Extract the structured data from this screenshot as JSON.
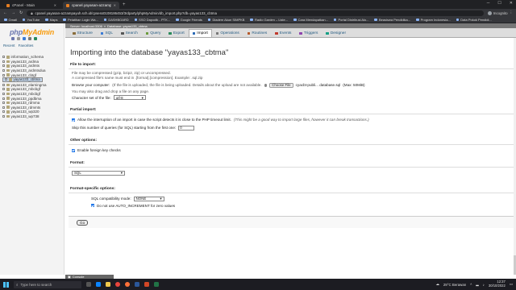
{
  "browser": {
    "tabs": [
      {
        "title": "cPanel - Main",
        "active": false
      },
      {
        "title": "cpanel.yayasan-azzampayuh.sch.id",
        "active": true
      }
    ],
    "new_tab_label": "+",
    "url": "cpanel.yayasan-azzampayuh.sch.id/cpsess0108186453/3rdparty/phpMyAdmin/db_import.php?db=yayas133_cbtma",
    "profile_label": "Incognito",
    "bookmarks": [
      "Gmail",
      "YouTube",
      "Maps",
      "Pelatihan Login Wa...",
      "DASHBOARD",
      "SSO Dapodik - PTK...",
      "Google Friends",
      "Diadem Akun SIMPKB",
      "Radio Garden – Liste...",
      "Cara Mendapatkan...",
      "Portal Distribusi Alo...",
      "Beasiswa Pendidika...",
      "Program Indonesia...",
      "Data Pokok Pendidi..."
    ]
  },
  "sidebar": {
    "logo_a": "php",
    "logo_b": "MyAdmin",
    "recent_label": "Recent",
    "favorites_label": "Favorites",
    "databases": [
      {
        "name": "information_schema",
        "selected": false
      },
      {
        "name": "yayas133_ardma",
        "selected": false
      },
      {
        "name": "yayas133_ardmts",
        "selected": false
      },
      {
        "name": "yayas133_ardmtsdua",
        "selected": false
      },
      {
        "name": "yayas133_cbtgf",
        "selected": false
      },
      {
        "name": "yayas133_cbtma",
        "selected": true
      },
      {
        "name": "yayas133_elarningma",
        "selected": false
      },
      {
        "name": "yayas133_mbcbgf",
        "selected": false
      },
      {
        "name": "yayas133_mbcbgf",
        "selected": false
      },
      {
        "name": "yayas133_ppdbma",
        "selected": false
      },
      {
        "name": "yayas133_rdmma",
        "selected": false
      },
      {
        "name": "yayas133_rdmmts",
        "selected": false
      },
      {
        "name": "yayas133_wp320",
        "selected": false
      },
      {
        "name": "yayas133_wp738",
        "selected": false
      }
    ]
  },
  "breadcrumb": {
    "server": "Server: localhost:3306",
    "database": "Database: yayas133_cbtma"
  },
  "nav_tabs": [
    {
      "label": "Structure",
      "icon": "structure-icon",
      "color": "#8a6d3b",
      "active": false
    },
    {
      "label": "SQL",
      "icon": "sql-icon",
      "color": "#3a7bd5",
      "active": false
    },
    {
      "label": "Search",
      "icon": "search-icon",
      "color": "#555555",
      "active": false
    },
    {
      "label": "Query",
      "icon": "query-icon",
      "color": "#6a9b3a",
      "active": false
    },
    {
      "label": "Export",
      "icon": "export-icon",
      "color": "#2a8a5a",
      "active": false
    },
    {
      "label": "Import",
      "icon": "import-icon",
      "color": "#2a6ab5",
      "active": true
    },
    {
      "label": "Operations",
      "icon": "operations-icon",
      "color": "#777777",
      "active": false
    },
    {
      "label": "Routines",
      "icon": "routines-icon",
      "color": "#b55a2a",
      "active": false
    },
    {
      "label": "Events",
      "icon": "events-icon",
      "color": "#c0392b",
      "active": false
    },
    {
      "label": "Triggers",
      "icon": "triggers-icon",
      "color": "#8e44ad",
      "active": false
    },
    {
      "label": "Designer",
      "icon": "designer-icon",
      "color": "#16a085",
      "active": false
    }
  ],
  "page": {
    "title": "Importing into the database \"yayas133_cbtma\"",
    "file_section": {
      "heading": "File to import:",
      "note1": "File may be compressed (gzip, bzip2, zip) or uncompressed.",
      "note2": "A compressed file's name must end in .[format].[compression]. Example: .sql.zip",
      "browse_label": "Browse your computer:",
      "browse_note": "(If the file is uploaded, the file is being uploaded. Details about the upload are not available.",
      "choose_button": "Choose File",
      "chosen_file": "cyacbt-publi... database.sql",
      "max_label": "(Max: 50MiB)",
      "drag_note": "You may also drag and drop a file on any page.",
      "charset_label": "Character set of the file:",
      "charset_value": "utf-8"
    },
    "partial_section": {
      "heading": "Partial import:",
      "interrupt_label": "Allow the interruption of an import in case the script detects it is close to the PHP timeout limit.",
      "interrupt_note": "(This might be a good way to import large files, however it can break transactions.)",
      "interrupt_checked": true,
      "skip_label": "Skip this number of queries (for SQL) starting from the first one:",
      "skip_value": "0"
    },
    "other_section": {
      "heading": "Other options:",
      "fk_label": "Enable foreign key checks",
      "fk_checked": true
    },
    "format_section": {
      "heading": "Format:",
      "format_value": "SQL"
    },
    "format_specific": {
      "heading": "Format-specific options:",
      "compat_label": "SQL compatibility mode:",
      "compat_value": "NONE",
      "auto_inc_label": "Do not use AUTO_INCREMENT for zero values",
      "auto_inc_checked": true
    },
    "go_button": "Go"
  },
  "console_label": "Console",
  "taskbar": {
    "search_placeholder": "Type here to search",
    "weather": "29°C  Berawan",
    "time": "12:37",
    "date": "30/10/2022"
  }
}
